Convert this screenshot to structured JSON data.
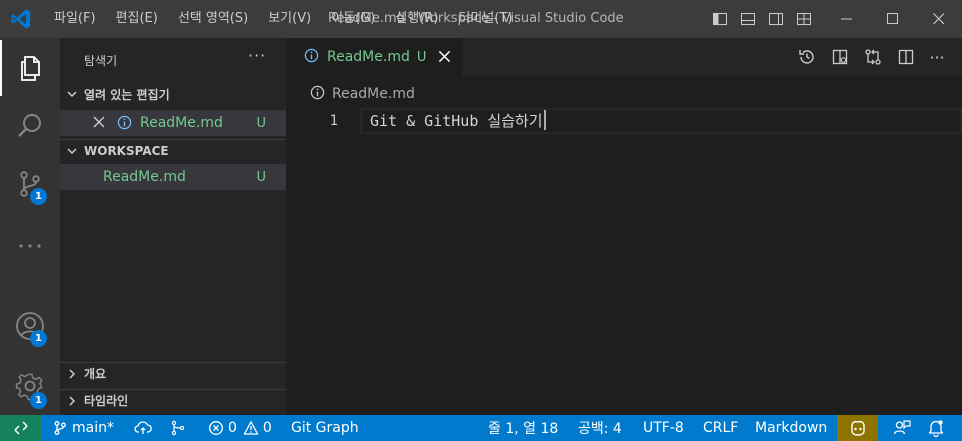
{
  "titlebar": {
    "menu": [
      "파일(F)",
      "편집(E)",
      "선택 영역(S)",
      "보기(V)",
      "이동(G)",
      "실행(R)",
      "터미널(T)"
    ],
    "title": "ReadMe.md - Workspace - Visual Studio Code",
    "logo_icon": "vscode-logo",
    "accent": "#0078d4"
  },
  "activitybar": {
    "items": [
      {
        "name": "explorer",
        "icon": "files-icon"
      },
      {
        "name": "search",
        "icon": "search-icon"
      },
      {
        "name": "source-control",
        "icon": "source-control-icon",
        "badge": "1"
      },
      {
        "name": "more",
        "icon": "ellipsis-icon"
      },
      {
        "name": "accounts",
        "icon": "account-icon",
        "badge": "1"
      },
      {
        "name": "manage",
        "icon": "gear-icon",
        "badge": "1"
      }
    ]
  },
  "sidebar": {
    "title": "탐색기",
    "more": "···",
    "open_editors": {
      "header": "열려 있는 편집기",
      "file": "ReadMe.md",
      "status": "U"
    },
    "workspace": {
      "header": "WORKSPACE",
      "file": "ReadMe.md",
      "status": "U"
    },
    "outline": "개요",
    "timeline": "타임라인"
  },
  "editor": {
    "tab": {
      "label": "ReadMe.md",
      "status": "U"
    },
    "breadcrumb": "ReadMe.md",
    "lines": [
      {
        "number": "1",
        "text": "Git & GitHub 실습하기"
      }
    ]
  },
  "statusbar": {
    "branch": "main*",
    "errors": "0",
    "warnings": "0",
    "git_graph": "Git Graph",
    "position": "줄 1, 열 18",
    "spaces": "공백: 4",
    "encoding": "UTF-8",
    "eol": "CRLF",
    "language": "Markdown",
    "colors": {
      "background": "#007acc",
      "remote": "#16825d",
      "copilot": "#8f7300"
    }
  },
  "colors": {
    "untracked": "#73c991"
  }
}
